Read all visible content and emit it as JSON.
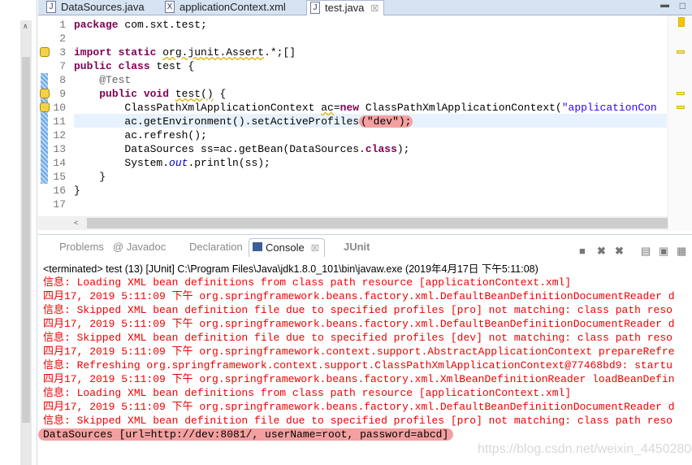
{
  "tabs": [
    {
      "label": "DataSources.java",
      "icon": "java-file-icon"
    },
    {
      "label": "applicationContext.xml",
      "icon": "xml-file-icon"
    },
    {
      "label": "test.java",
      "icon": "java-file-icon",
      "active": true
    }
  ],
  "editor": {
    "lines": [
      {
        "n": "1",
        "segs": [
          {
            "t": "package",
            "c": "kw"
          },
          {
            "t": " com.sxt.test;"
          }
        ]
      },
      {
        "n": "2",
        "segs": []
      },
      {
        "n": "3",
        "segs": [
          {
            "t": "import static",
            "c": "kw"
          },
          {
            "t": " "
          },
          {
            "t": "org.junit.Assert",
            "c": "sq"
          },
          {
            "t": ".*;"
          },
          {
            "t": "[]"
          }
        ]
      },
      {
        "n": "7",
        "segs": [
          {
            "t": "public class",
            "c": "kw"
          },
          {
            "t": " test {"
          }
        ]
      },
      {
        "n": "8",
        "segs": [
          {
            "t": "    @Test",
            "c": "an"
          }
        ]
      },
      {
        "n": "9",
        "segs": [
          {
            "t": "    "
          },
          {
            "t": "public void",
            "c": "kw"
          },
          {
            "t": " "
          },
          {
            "t": "test()",
            "c": "sq"
          },
          {
            "t": " {"
          }
        ]
      },
      {
        "n": "10",
        "segs": [
          {
            "t": "        ClassPathXmlApplicationContext "
          },
          {
            "t": "ac",
            "c": "sq"
          },
          {
            "t": "="
          },
          {
            "t": "new",
            "c": "kw"
          },
          {
            "t": " ClassPathXmlApplicationContext("
          },
          {
            "t": "\"applicationCon",
            "c": "st"
          }
        ]
      },
      {
        "n": "11",
        "segs": [
          {
            "t": "        ac.getEnvironment().setActiveProfiles"
          },
          {
            "t": "(\"dev\");",
            "c": "hl"
          }
        ]
      },
      {
        "n": "12",
        "segs": [
          {
            "t": "        ac.refresh();"
          }
        ]
      },
      {
        "n": "13",
        "segs": [
          {
            "t": "        DataSources ss=ac.getBean(DataSources."
          },
          {
            "t": "class",
            "c": "kw"
          },
          {
            "t": ");"
          }
        ]
      },
      {
        "n": "14",
        "segs": [
          {
            "t": "        System."
          },
          {
            "t": "out",
            "c": "fd"
          },
          {
            "t": ".println(ss);"
          }
        ]
      },
      {
        "n": "15",
        "segs": [
          {
            "t": "    }"
          }
        ]
      },
      {
        "n": "16",
        "segs": [
          {
            "t": "}"
          }
        ]
      },
      {
        "n": "17",
        "segs": []
      }
    ]
  },
  "console": {
    "tabs": [
      {
        "label": "Problems"
      },
      {
        "label": "Javadoc"
      },
      {
        "label": "Declaration"
      },
      {
        "label": "Console",
        "active": true
      },
      {
        "label": "JUnit"
      }
    ],
    "status": "<terminated> test (13) [JUnit] C:\\Program Files\\Java\\jdk1.8.0_101\\bin\\javaw.exe (2019年4月17日 下午5:11:08)",
    "lines": [
      "信息: Loading XML bean definitions from class path resource [applicationContext.xml]",
      "四月17, 2019 5:11:09 下午 org.springframework.beans.factory.xml.DefaultBeanDefinitionDocumentReader d",
      "信息: Skipped XML bean definition file due to specified profiles [pro] not matching: class path reso",
      "四月17, 2019 5:11:09 下午 org.springframework.beans.factory.xml.DefaultBeanDefinitionDocumentReader d",
      "信息: Skipped XML bean definition file due to specified profiles [dev] not matching: class path reso",
      "四月17, 2019 5:11:09 下午 org.springframework.context.support.AbstractApplicationContext prepareRefre",
      "信息: Refreshing org.springframework.context.support.ClassPathXmlApplicationContext@77468bd9: startu",
      "四月17, 2019 5:11:09 下午 org.springframework.beans.factory.xml.XmlBeanDefinitionReader loadBeanDefin",
      "信息: Loading XML bean definitions from class path resource [applicationContext.xml]",
      "四月17, 2019 5:11:09 下午 org.springframework.beans.factory.xml.DefaultBeanDefinitionDocumentReader d",
      "信息: Skipped XML bean definition file due to specified profiles [pro] not matching: class path reso"
    ],
    "output": "DataSources [url=http://dev:8081/, userName=root, password=abcd]"
  },
  "watermark": "https://blog.csdn.net/weixin_44502804"
}
